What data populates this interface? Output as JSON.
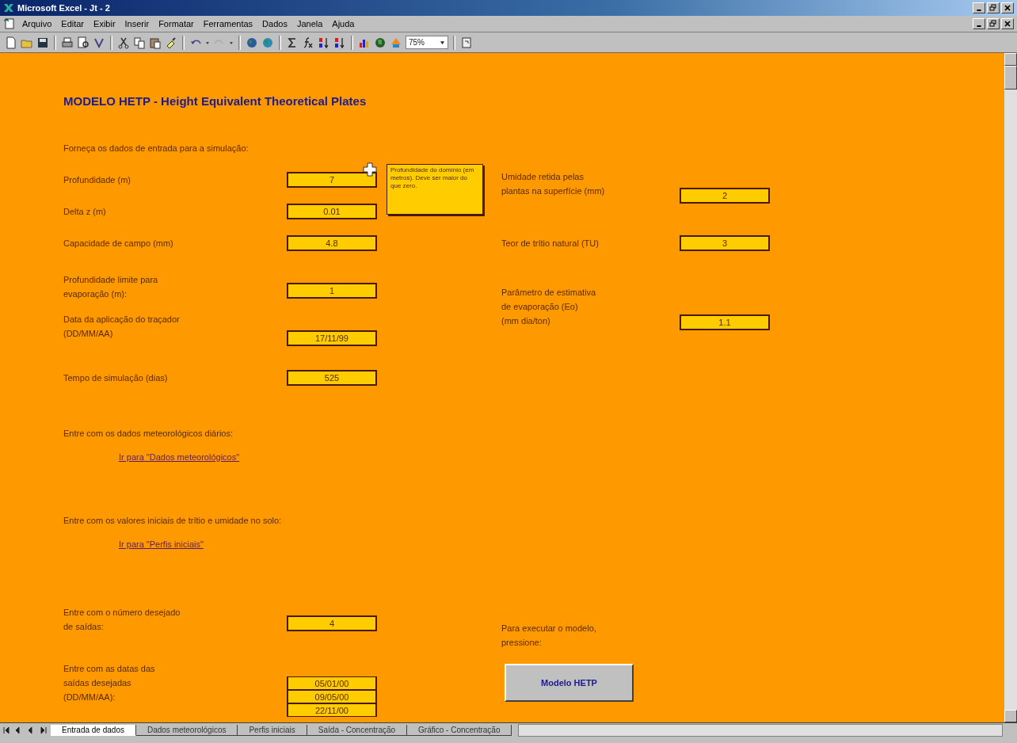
{
  "window": {
    "title": "Microsoft Excel - Jt - 2"
  },
  "menu": [
    "Arquivo",
    "Editar",
    "Exibir",
    "Inserir",
    "Formatar",
    "Ferramentas",
    "Dados",
    "Janela",
    "Ajuda"
  ],
  "toolbar": {
    "zoom": "75%"
  },
  "sheet": {
    "title": "MODELO HETP - Height Equivalent Theoretical Plates",
    "intro": "Forneça os dados de entrada para a simulação:",
    "left_inputs": [
      {
        "label": "Profundidade (m)",
        "value": "7"
      },
      {
        "label": "Delta z (m)",
        "value": "0.01"
      },
      {
        "label": "Capacidade de campo (mm)",
        "value": "4.8"
      },
      {
        "label": "Profundidade limite para\nevaporação (m):",
        "value": "1"
      },
      {
        "label": "Data da aplicação do traçador\n(DD/MM/AA)",
        "value": "17/11/99"
      },
      {
        "label": "Tempo de simulação (dias)",
        "value": "525"
      }
    ],
    "right_inputs": [
      {
        "label": "Umidade retida pelas\nplantas na superfície (mm)",
        "value": "2"
      },
      {
        "label": "Teor de trítio natural (TU)",
        "value": "3"
      },
      {
        "label": "Parâmetro de estimativa\nde evaporação (Eo)\n(mm dia/ton)",
        "value": "1.1"
      }
    ],
    "sections": [
      {
        "text": "Entre com os dados meteorológicos diários:",
        "link": "Ir para \"Dados meteorológicos\""
      },
      {
        "text": "Entre com os valores iniciais de trítio e umidade no solo:",
        "link": "Ir para \"Perfis iniciais\""
      }
    ],
    "outputs": {
      "label": "Entre com o número desejado\nde saídas:",
      "value": "4"
    },
    "dates": {
      "label": "Entre com as datas das\nsaídas desejadas\n(DD/MM/AA):",
      "values": [
        "05/01/00",
        "09/05/00",
        "22/11/00"
      ]
    },
    "run": {
      "label": "Para executar o modelo,\npressione:",
      "button": "Modelo HETP"
    },
    "tooltip": "Profundidade do domínio (em metros). Deve ser maior do que zero."
  },
  "sheet_tabs": [
    {
      "label": "Entrada de dados",
      "selected": true
    },
    {
      "label": "Dados meteorológicos",
      "selected": false
    },
    {
      "label": "Perfis iniciais",
      "selected": false
    },
    {
      "label": "Saída - Concentração",
      "selected": false
    },
    {
      "label": "Gráfico - Concentração",
      "selected": false
    }
  ]
}
